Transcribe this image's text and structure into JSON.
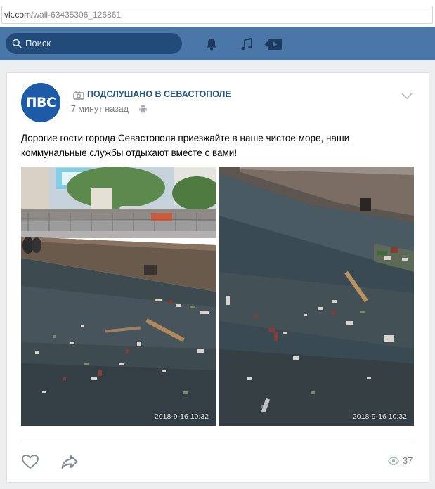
{
  "browser": {
    "url_domain": "vk.com",
    "url_path": "/wall-63435306_126861"
  },
  "header": {
    "search_placeholder": "Поиск",
    "icons": [
      "search-icon",
      "bell-icon",
      "music-note-icon",
      "video-play-icon"
    ],
    "colors": {
      "bar": "#4a76a8",
      "search_field": "#224b7a"
    }
  },
  "post": {
    "avatar_text": "ПВС",
    "community_name": "ПОДСЛУШАНО В СЕВАСТОПОЛЕ",
    "time": "7 минут назад",
    "text": "Дорогие гости города Севастополя приезжайте в наше чистое море, наши коммунальные службы отдыхают вместе с вами!",
    "photos": [
      {
        "stamp": "2018-9-16 10:32"
      },
      {
        "stamp": "2018-9-16 10:32"
      }
    ],
    "views": "37",
    "icons": [
      "camera-icon",
      "android-icon",
      "chevron-down-icon",
      "heart-icon",
      "share-arrow-icon",
      "eye-icon"
    ],
    "colors": {
      "link": "#2a5885",
      "avatar": "#1d5aa8",
      "meta": "#828282"
    }
  }
}
